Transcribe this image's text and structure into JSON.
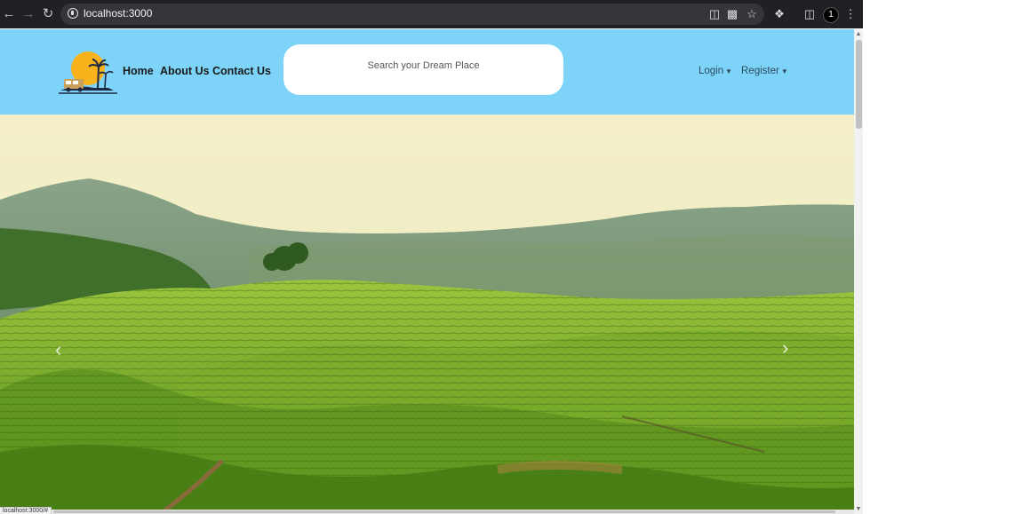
{
  "browser": {
    "url": "localhost:3000",
    "status_url": "localhost:3000/#",
    "profile_initial": "1",
    "icons": {
      "back": "arrow-left-icon",
      "forward": "arrow-right-icon",
      "reload": "reload-icon",
      "site_info": "site-info-icon",
      "cast": "cast-icon",
      "translate": "translate-icon",
      "bookmark": "star-icon",
      "extensions": "puzzle-icon",
      "side_panel": "side-panel-icon",
      "menu": "kebab-menu-icon"
    }
  },
  "header": {
    "background": "#7dd4f8",
    "nav": {
      "home": "Home",
      "about": "About Us",
      "contact": "Contact Us"
    },
    "search": {
      "placeholder": "Search your Dream Place",
      "value": ""
    },
    "auth": {
      "login": "Login",
      "register": "Register"
    }
  },
  "hero": {
    "image": "tea-plantation-hills",
    "prev_icon": "chevron-left-icon",
    "next_icon": "chevron-right-icon"
  }
}
